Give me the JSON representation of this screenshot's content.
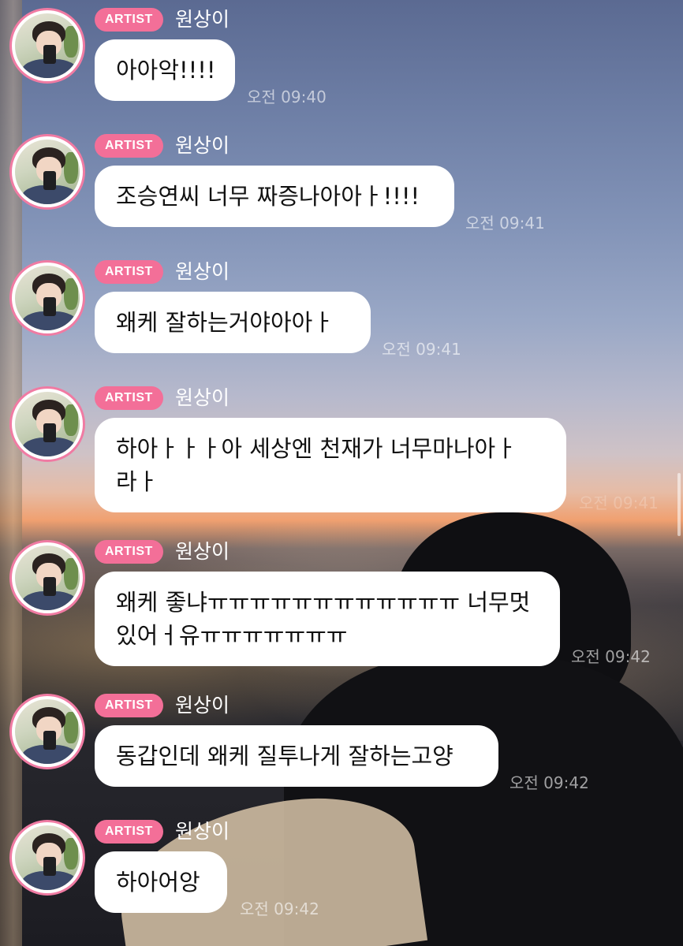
{
  "chat": {
    "messages": [
      {
        "badge": "ARTIST",
        "name": "원상이",
        "lines": [
          "아아악!!!!"
        ],
        "time": "오전 09:40"
      },
      {
        "badge": "ARTIST",
        "name": "원상이",
        "lines": [
          "조승연씨 너무 짜증나아아ㅏ!!!!"
        ],
        "time": "오전 09:41"
      },
      {
        "badge": "ARTIST",
        "name": "원상이",
        "lines": [
          "왜케 잘하는거야아아ㅏ"
        ],
        "time": "오전 09:41"
      },
      {
        "badge": "ARTIST",
        "name": "원상이",
        "lines": [
          "하아ㅏㅏㅏ아 세상엔 천재가 너무마나아ㅏ",
          "라ㅏ"
        ],
        "time": "오전 09:41"
      },
      {
        "badge": "ARTIST",
        "name": "원상이",
        "lines": [
          "왜케 좋냐ㅠㅠㅠㅠㅠㅠㅠㅠㅠㅠㅠㅠ 너무멋",
          "있어ㅓ유ㅠㅠㅠㅠㅠㅠㅠ"
        ],
        "time": "오전 09:42"
      },
      {
        "badge": "ARTIST",
        "name": "원상이",
        "lines": [
          "동갑인데 왜케 질투나게 잘하는고양"
        ],
        "time": "오전 09:42"
      },
      {
        "badge": "ARTIST",
        "name": "원상이",
        "lines": [
          "하아어앙"
        ],
        "time": "오전 09:42"
      }
    ]
  }
}
